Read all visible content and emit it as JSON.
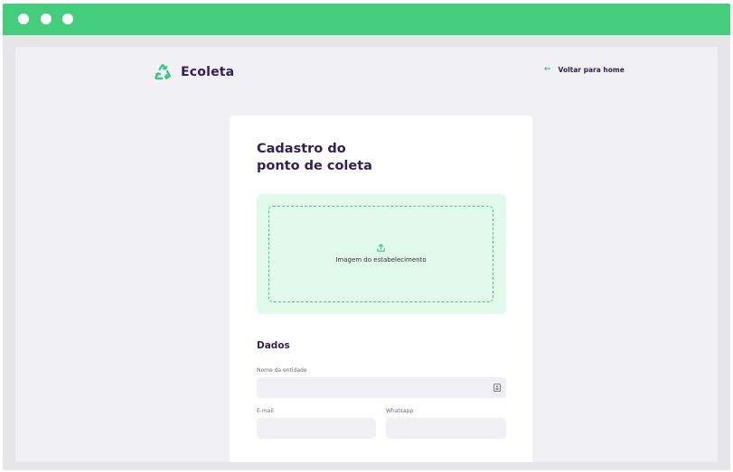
{
  "window": {
    "controls": [
      "close-dot",
      "minimize-dot",
      "maximize-dot"
    ]
  },
  "header": {
    "logo_text": "Ecoleta",
    "logo_icon": "recycle-icon",
    "back_link": "Voltar para home",
    "back_icon": "arrow-left-icon"
  },
  "form": {
    "title_line1": "Cadastro do",
    "title_line2": "ponto de coleta",
    "dropzone": {
      "icon": "upload-icon",
      "label": "Imagem do estabelecimento"
    },
    "section_title": "Dados",
    "fields": {
      "name_label": "Nome da entidade",
      "name_value": "",
      "email_label": "E-mail",
      "email_value": "",
      "whatsapp_label": "Whatsapp",
      "whatsapp_value": ""
    }
  },
  "colors": {
    "brand_green": "#34cb79",
    "titlebar_green": "#44cd7d",
    "title_purple": "#322153",
    "background": "#f0f0f5",
    "dropzone_bg": "#e1faec"
  }
}
